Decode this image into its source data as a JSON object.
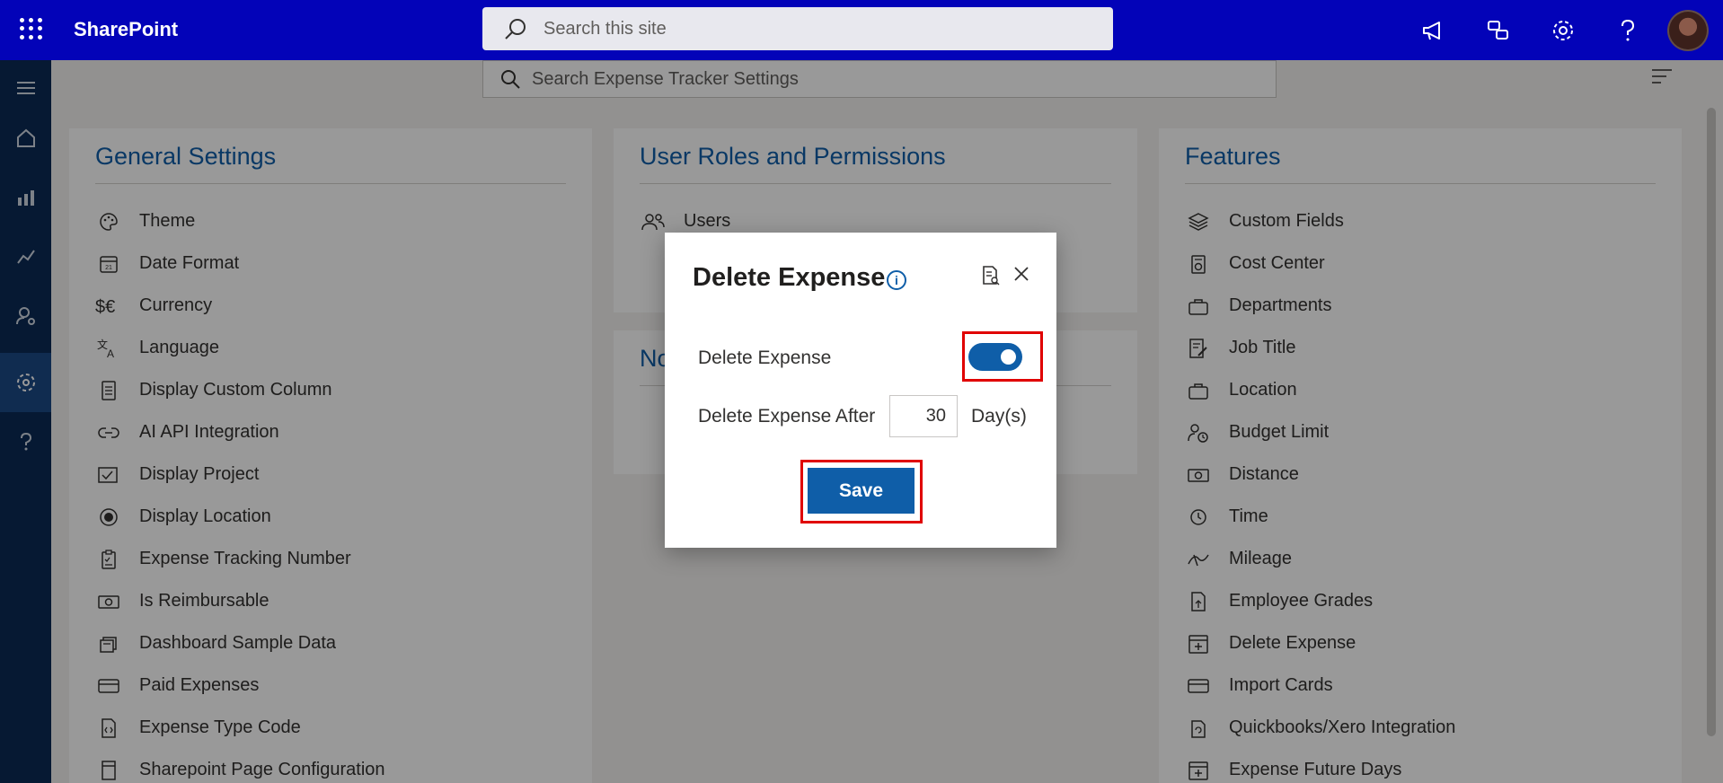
{
  "app": {
    "brand": "SharePoint"
  },
  "site_search": {
    "placeholder": "Search this site"
  },
  "settings_search": {
    "placeholder": "Search Expense Tracker Settings"
  },
  "cards": {
    "general": {
      "title": "General Settings",
      "items": [
        {
          "label": "Theme",
          "icon": "palette-icon"
        },
        {
          "label": "Date Format",
          "icon": "calendar-icon"
        },
        {
          "label": "Currency",
          "icon": "currency-icon"
        },
        {
          "label": "Language",
          "icon": "language-icon"
        },
        {
          "label": "Display Custom Column",
          "icon": "document-icon"
        },
        {
          "label": "AI API Integration",
          "icon": "link-icon"
        },
        {
          "label": "Display Project",
          "icon": "project-icon"
        },
        {
          "label": "Display Location",
          "icon": "radio-icon"
        },
        {
          "label": "Expense Tracking Number",
          "icon": "clipboard-icon"
        },
        {
          "label": "Is Reimbursable",
          "icon": "money-icon"
        },
        {
          "label": "Dashboard Sample Data",
          "icon": "stack-icon"
        },
        {
          "label": "Paid Expenses",
          "icon": "card-icon"
        },
        {
          "label": "Expense Type Code",
          "icon": "code-icon"
        },
        {
          "label": "Sharepoint Page Configuration",
          "icon": "page-icon"
        }
      ]
    },
    "roles": {
      "title": "User Roles and Permissions",
      "items": [
        {
          "label": "Users",
          "icon": "users-icon"
        }
      ]
    },
    "notifications": {
      "title": "No"
    },
    "features": {
      "title": "Features",
      "items": [
        {
          "label": "Custom Fields",
          "icon": "layers-icon"
        },
        {
          "label": "Cost Center",
          "icon": "cost-center-icon"
        },
        {
          "label": "Departments",
          "icon": "briefcase-icon"
        },
        {
          "label": "Job Title",
          "icon": "edit-doc-icon"
        },
        {
          "label": "Location",
          "icon": "location-icon"
        },
        {
          "label": "Budget Limit",
          "icon": "person-clock-icon"
        },
        {
          "label": "Distance",
          "icon": "money-icon"
        },
        {
          "label": "Time",
          "icon": "clock-icon"
        },
        {
          "label": "Mileage",
          "icon": "mileage-icon"
        },
        {
          "label": "Employee Grades",
          "icon": "doc-arrow-icon"
        },
        {
          "label": "Delete Expense",
          "icon": "calendar-add-icon"
        },
        {
          "label": "Import Cards",
          "icon": "card-icon"
        },
        {
          "label": "Quickbooks/Xero Integration",
          "icon": "sync-icon"
        },
        {
          "label": "Expense Future Days",
          "icon": "calendar-add-icon"
        }
      ]
    }
  },
  "dialog": {
    "title": "Delete Expense",
    "info": "i",
    "toggle_label": "Delete Expense",
    "toggle_on": true,
    "after_label": "Delete Expense After",
    "after_value": "30",
    "unit": "Day(s)",
    "save_label": "Save"
  },
  "colors": {
    "suite_bar": "#0303b8",
    "rail": "#0a2a55",
    "accent": "#0f5ea8",
    "highlight": "#e00000"
  }
}
